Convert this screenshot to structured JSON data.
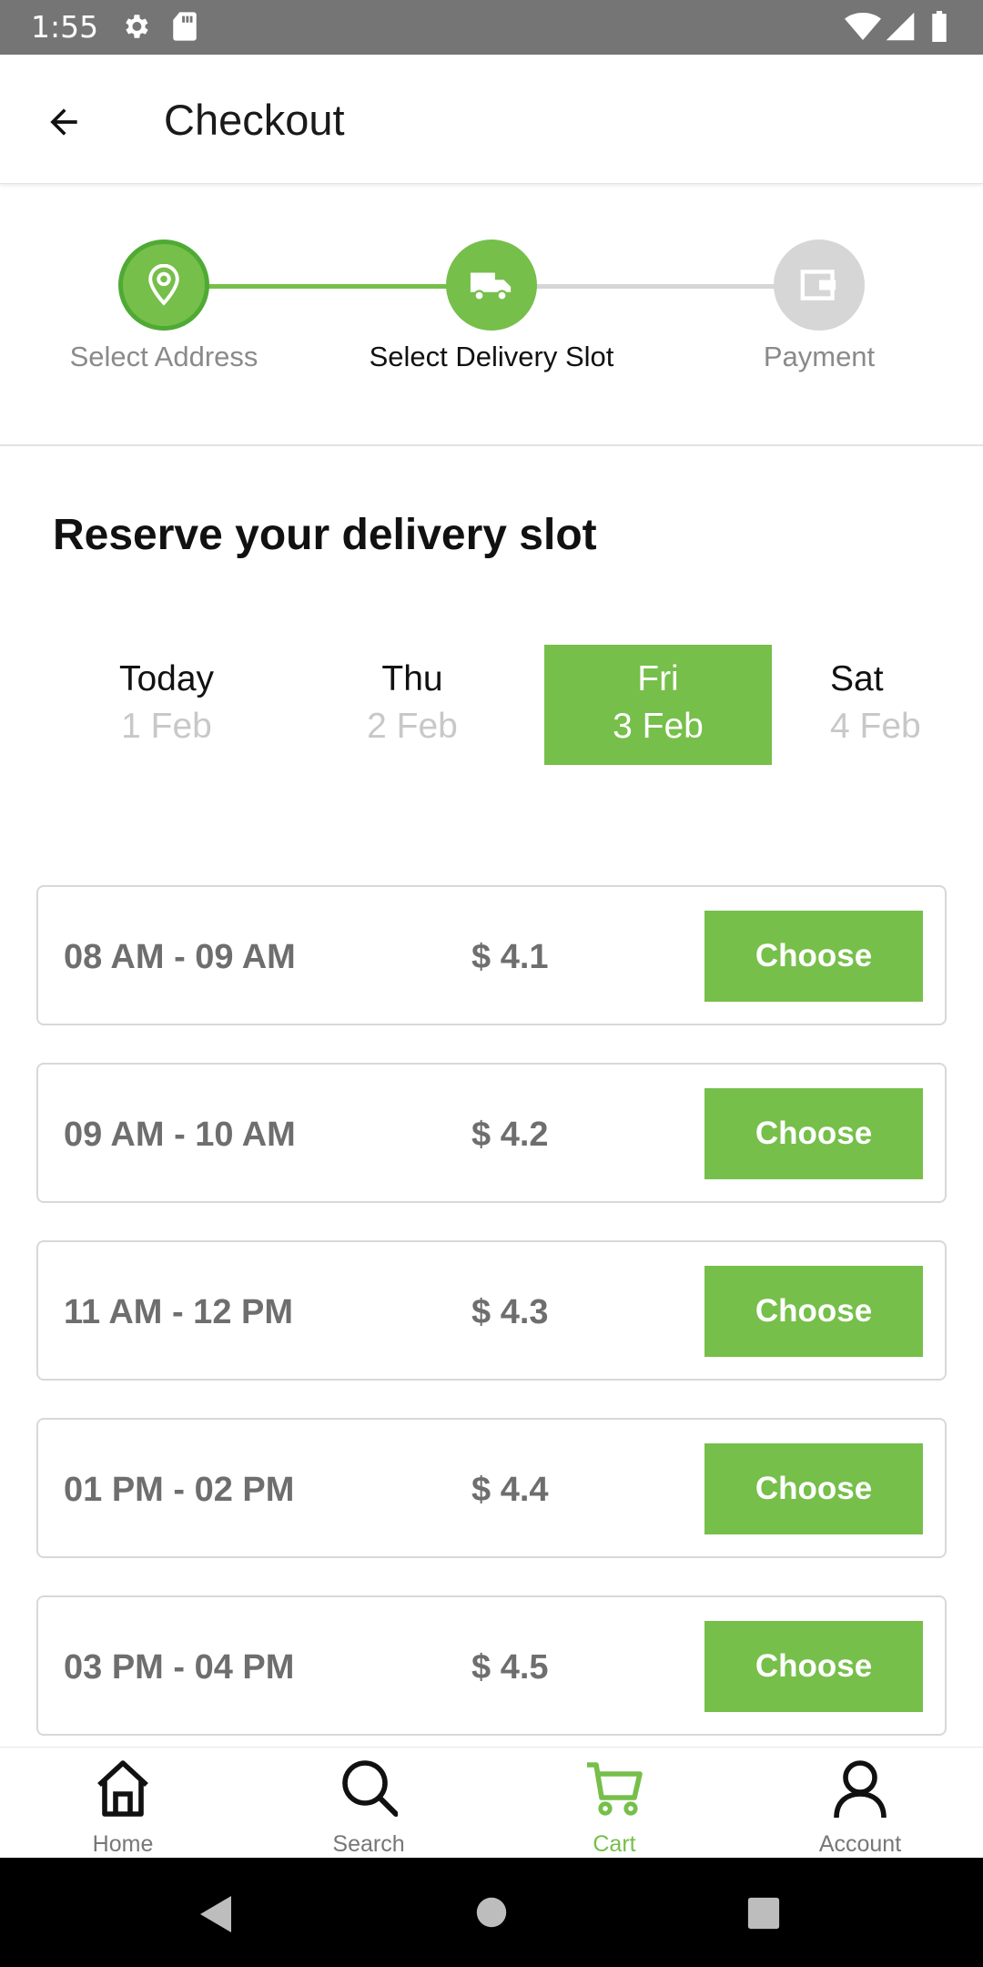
{
  "status_bar": {
    "time": "1:55",
    "icons": [
      "gear-icon",
      "sd-card-icon",
      "wifi-icon",
      "signal-icon",
      "battery-icon"
    ]
  },
  "app_bar": {
    "title": "Checkout",
    "back_icon": "arrow-left-icon"
  },
  "stepper": {
    "steps": [
      {
        "label": "Select Address",
        "icon": "location-pin-icon",
        "state": "completed"
      },
      {
        "label": "Select Delivery Slot",
        "icon": "truck-icon",
        "state": "current"
      },
      {
        "label": "Payment",
        "icon": "wallet-icon",
        "state": "pending"
      }
    ]
  },
  "section_title": "Reserve your delivery slot",
  "dates": [
    {
      "day": "Today",
      "date": "1 Feb",
      "selected": false
    },
    {
      "day": "Thu",
      "date": "2 Feb",
      "selected": false
    },
    {
      "day": "Fri",
      "date": "3 Feb",
      "selected": true
    },
    {
      "day": "Sat",
      "date": "4 Feb",
      "selected": false
    }
  ],
  "slots": [
    {
      "time": "08 AM - 09 AM",
      "price": "$ 4.1",
      "button": "Choose"
    },
    {
      "time": "09 AM - 10 AM",
      "price": "$ 4.2",
      "button": "Choose"
    },
    {
      "time": "11 AM - 12 PM",
      "price": "$ 4.3",
      "button": "Choose"
    },
    {
      "time": "01 PM - 02 PM",
      "price": "$ 4.4",
      "button": "Choose"
    },
    {
      "time": "03 PM - 04 PM",
      "price": "$ 4.5",
      "button": "Choose"
    }
  ],
  "bottom_nav": {
    "items": [
      {
        "label": "Home",
        "icon": "home-icon",
        "active": false
      },
      {
        "label": "Search",
        "icon": "search-icon",
        "active": false
      },
      {
        "label": "Cart",
        "icon": "cart-icon",
        "active": true
      },
      {
        "label": "Account",
        "icon": "account-icon",
        "active": false
      }
    ]
  },
  "colors": {
    "accent": "#76bf4a",
    "status_bar": "#757575",
    "inactive_step": "#d6d6d6",
    "muted_text": "#777777"
  }
}
